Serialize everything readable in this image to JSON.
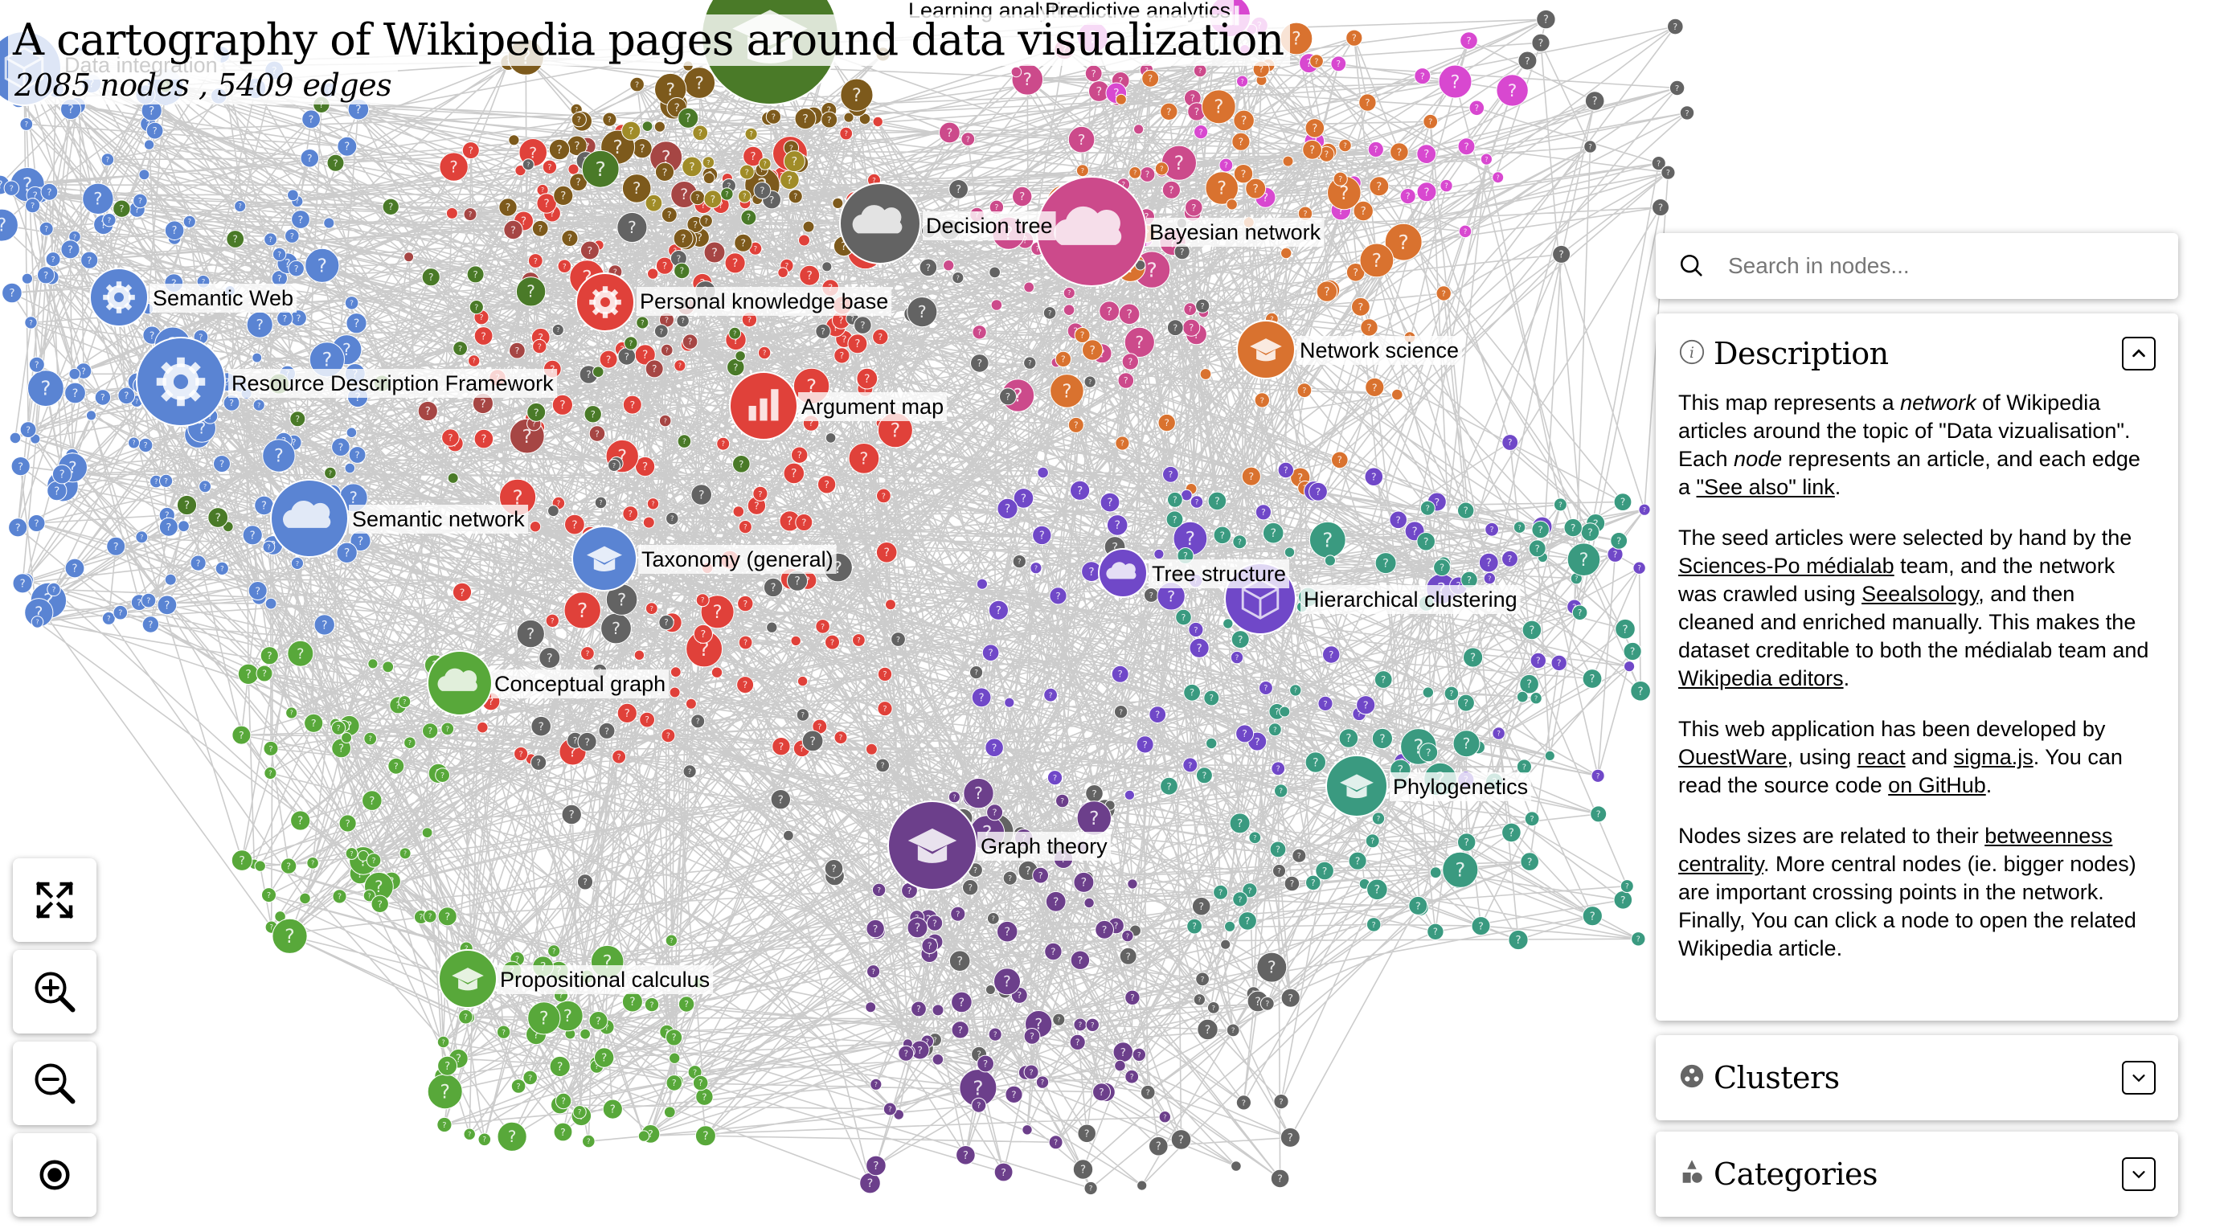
{
  "header": {
    "title": "A cartography of Wikipedia pages around data visualization",
    "subtitle": "2085 nodes , 5409 edges"
  },
  "search": {
    "placeholder": "Search in nodes...",
    "value": "",
    "icon": "search-icon"
  },
  "controls": [
    {
      "name": "fullscreen-button",
      "icon": "expand-icon"
    },
    {
      "name": "zoom-in-button",
      "icon": "zoom-in-icon"
    },
    {
      "name": "zoom-out-button",
      "icon": "zoom-out-icon"
    },
    {
      "name": "reset-view-button",
      "icon": "target-icon"
    }
  ],
  "panels": {
    "description": {
      "title": "Description",
      "icon": "info-icon",
      "expanded": true,
      "p1": {
        "t1": "This map represents a ",
        "em1": "network",
        "t2": " of Wikipedia articles around the topic of \"Data vizualisation\". Each ",
        "em2": "node",
        "t3": " represents an article, and each edge a ",
        "link1": "\"See also\" link",
        "t4": "."
      },
      "p2": {
        "t1": "The seed articles were selected by hand by the ",
        "link1": "Sciences-Po médialab",
        "t2": " team, and the network was crawled using ",
        "link2": "Seealsology",
        "t3": ", and then cleaned and enriched manually. This makes the dataset creditable to both the médialab team and ",
        "link3": "Wikipedia editors",
        "t4": "."
      },
      "p3": {
        "t1": "This web application has been developed by ",
        "link1": "OuestWare",
        "t2": ", using ",
        "link2": "react",
        "t3": " and ",
        "link3": "sigma.js",
        "t4": ". You can read the source code ",
        "link4": "on GitHub",
        "t5": "."
      },
      "p4": {
        "t1": "Nodes sizes are related to their ",
        "link1": "betweenness centrality",
        "t2": ". More central nodes (ie. bigger nodes) are important crossing points in the network. Finally, You can click a node to open the related Wikipedia article."
      }
    },
    "clusters": {
      "title": "Clusters",
      "icon": "clusters-icon",
      "expanded": false
    },
    "categories": {
      "title": "Categories",
      "icon": "categories-icon",
      "expanded": false
    }
  },
  "graph": {
    "colors": {
      "blue": "#5a84d3",
      "red": "#e0413a",
      "darkred": "#a64644",
      "green": "#58a83a",
      "darkgreen": "#4a7a28",
      "purple": "#6c3f8b",
      "violet": "#7048c8",
      "teal": "#3a9a80",
      "orange": "#d9722f",
      "pink": "#cc4a8b",
      "magenta": "#d848d0",
      "brown": "#7d5a1c",
      "gray": "#636363",
      "olive": "#a08c28",
      "edge": "#cccccc"
    },
    "labeled_nodes": [
      {
        "label": "Semantic Web",
        "color": "blue",
        "icon": "gear-icon"
      },
      {
        "label": "Resource Description Framework",
        "color": "blue",
        "icon": "gear-icon"
      },
      {
        "label": "Personal knowledge base",
        "color": "red",
        "icon": "gear-icon"
      },
      {
        "label": "Decision tree",
        "color": "gray",
        "icon": "cloud-icon"
      },
      {
        "label": "Bayesian network",
        "color": "pink",
        "icon": "cloud-icon"
      },
      {
        "label": "Network science",
        "color": "orange",
        "icon": "graduation-cap-icon"
      },
      {
        "label": "Argument map",
        "color": "red",
        "icon": "bar-chart-icon"
      },
      {
        "label": "Semantic network",
        "color": "blue",
        "icon": "cloud-icon"
      },
      {
        "label": "Taxonomy (general)",
        "color": "blue",
        "icon": "graduation-cap-icon"
      },
      {
        "label": "Tree structure",
        "color": "violet",
        "icon": "cloud-icon"
      },
      {
        "label": "Hierarchical clustering",
        "color": "violet",
        "icon": "cube-icon"
      },
      {
        "label": "Conceptual graph",
        "color": "green",
        "icon": "cloud-icon"
      },
      {
        "label": "Phylogenetics",
        "color": "teal",
        "icon": "graduation-cap-icon"
      },
      {
        "label": "Graph theory",
        "color": "purple",
        "icon": "graduation-cap-icon"
      },
      {
        "label": "Propositional calculus",
        "color": "green",
        "icon": "graduation-cap-icon"
      },
      {
        "label": "Learning analytics",
        "color": "darkgreen",
        "icon": "graduation-cap-icon"
      },
      {
        "label": "Predictive analytics",
        "color": "magenta",
        "icon": "bar-chart-icon"
      },
      {
        "label": "Data integration",
        "color": "blue",
        "icon": "cube-icon"
      }
    ]
  }
}
